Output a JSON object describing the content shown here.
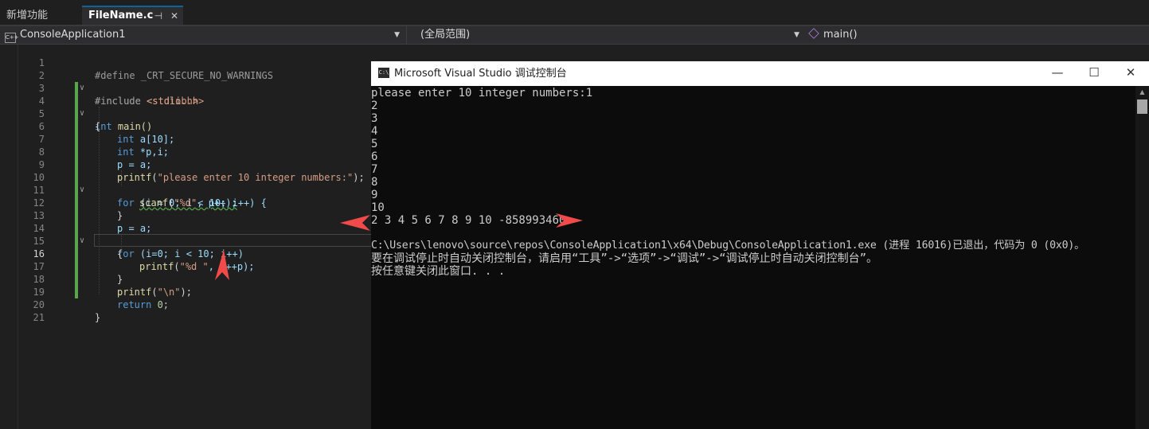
{
  "tabs": [
    {
      "label": "新增功能",
      "active": false
    },
    {
      "label": "FileName.c",
      "active": true,
      "pin_glyph": "⊣",
      "close_glyph": "✕"
    }
  ],
  "navbar": {
    "project": "ConsoleApplication1",
    "project_icon": "C++",
    "scope": "(全局范围)",
    "function": "main()"
  },
  "editor": {
    "lines": [
      {
        "n": "1",
        "html_key": "l1"
      },
      {
        "n": "2"
      },
      {
        "n": "3"
      },
      {
        "n": "4"
      },
      {
        "n": "5"
      },
      {
        "n": "6"
      },
      {
        "n": "7"
      },
      {
        "n": "8"
      },
      {
        "n": "9"
      },
      {
        "n": "10"
      },
      {
        "n": "11"
      },
      {
        "n": "12"
      },
      {
        "n": "13"
      },
      {
        "n": "14"
      },
      {
        "n": "15"
      },
      {
        "n": "16"
      },
      {
        "n": "17"
      },
      {
        "n": "18"
      },
      {
        "n": "19"
      },
      {
        "n": "20"
      },
      {
        "n": "21"
      }
    ],
    "code": {
      "l1": "#define _CRT_SECURE_NO_WARNINGS",
      "l2a": "#include ",
      "l2b": "<stdio.h>",
      "l3a": "#include ",
      "l3b": "<stdlib.h>",
      "l4a": "int",
      "l4b": " main()",
      "l5": "{",
      "l6a": "int",
      "l6b": " a[10];",
      "l7a": "int",
      "l7b": " *p,i;",
      "l8": "p = a;",
      "l9a": "printf",
      "l9b": "(",
      "l9c": "\"please enter 10 integer numbers:\"",
      "l9d": ");",
      "l10a": "for",
      "l10b": " (i = 0; i < 10; i++) {",
      "l11a": "scanf",
      "l11b": "(",
      "l11c": "\"%d\"",
      "l11d": ", p++);",
      "l12": "}",
      "l13": "p = a;",
      "l14a": "for",
      "l14b": " (i=0; i < 10; i++)",
      "l15": "{",
      "l16a": "printf",
      "l16b": "(",
      "l16c": "\"%d \"",
      "l16d": ", *++p);",
      "l17": "}",
      "l18a": "printf",
      "l18b": "(",
      "l18c": "\"\\n\"",
      "l18d": ");",
      "l19a": "return",
      "l19b": " 0;",
      "l20": "}"
    },
    "current_line": "16"
  },
  "console": {
    "title": "Microsoft Visual Studio 调试控制台",
    "icon": "C:\\",
    "buttons": {
      "minimize": "—",
      "maximize": "☐",
      "close": "✕"
    },
    "lines": [
      "please enter 10 integer numbers:1",
      "2",
      "3",
      "4",
      "5",
      "6",
      "7",
      "8",
      "9",
      "10",
      "2 3 4 5 6 7 8 9 10 -858993460",
      "",
      "C:\\Users\\lenovo\\source\\repos\\ConsoleApplication1\\x64\\Debug\\ConsoleApplication1.exe (进程 16016)已退出，代码为 0 (0x0)。",
      "要在调试停止时自动关闭控制台，请启用“工具”->“选项”->“调试”->“调试停止时自动关闭控制台”。",
      "按任意键关闭此窗口. . ."
    ]
  },
  "colors": {
    "annotation_arrow": "#f04a4a",
    "change_bar": "#57a64a",
    "keyword": "#569cd6",
    "string": "#d69d85",
    "function": "#dcdcaa"
  }
}
